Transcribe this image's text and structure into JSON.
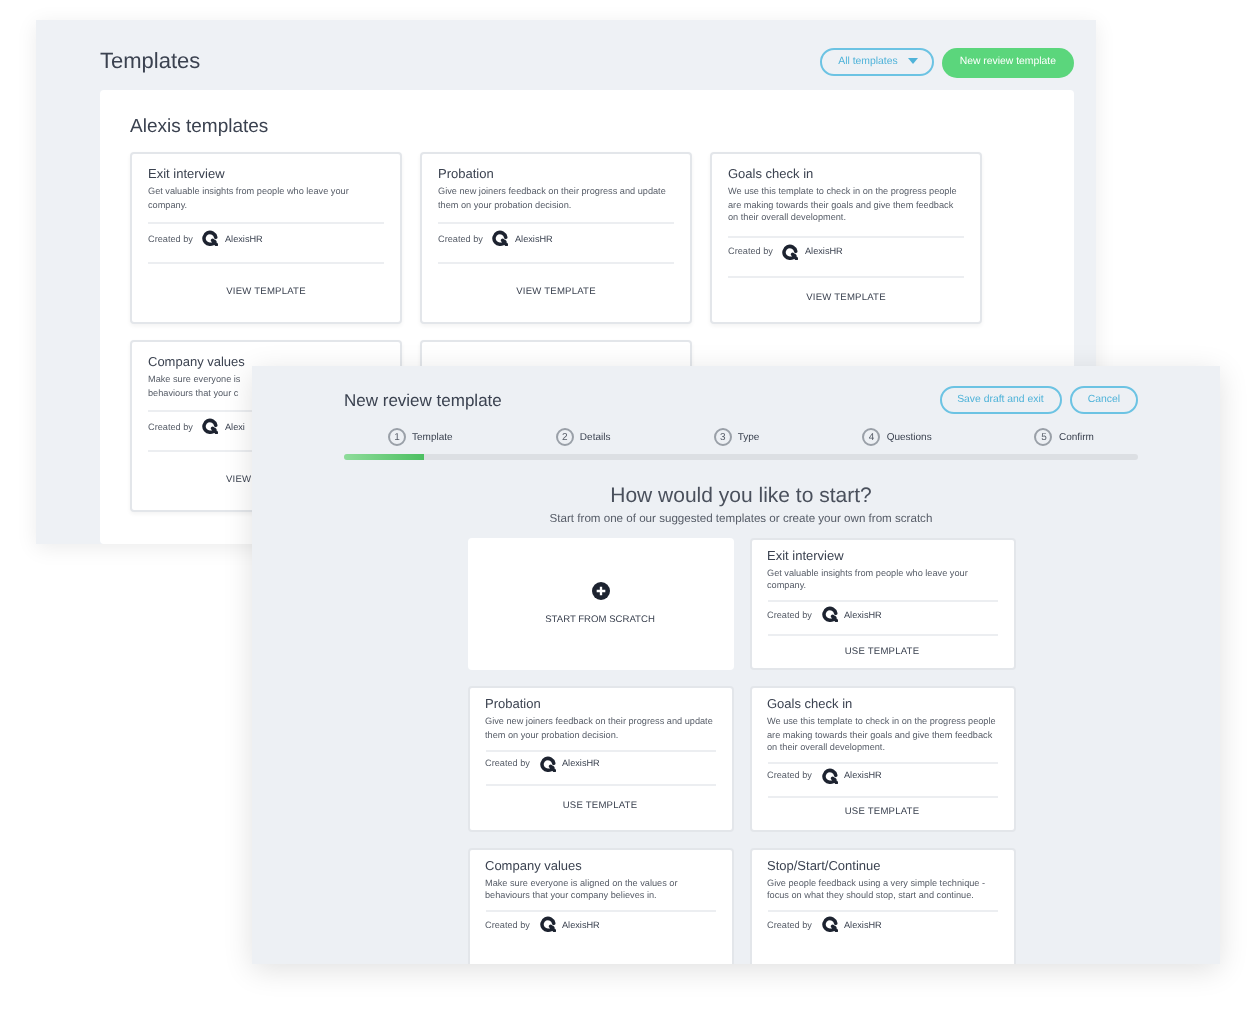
{
  "back_window": {
    "title": "Templates",
    "filter": {
      "label": "All templates"
    },
    "primary_button": "New review template",
    "section_title": "Alexis templates",
    "cards": [
      {
        "kind": "template",
        "title": "Exit interview",
        "description": "Get valuable insights from people who leave your company.",
        "created_by_label": "Created by",
        "creator": "AlexisHR",
        "action": "VIEW TEMPLATE"
      },
      {
        "kind": "template",
        "title": "Probation",
        "description": "Give new joiners feedback on their progress and update them on your probation decision.",
        "created_by_label": "Created by",
        "creator": "AlexisHR",
        "action": "VIEW TEMPLATE"
      },
      {
        "kind": "template",
        "title": "Goals check in",
        "description": "We use this template to check in on the progress people are making towards their goals and give them feedback on their overall development.",
        "created_by_label": "Created by",
        "creator": "AlexisHR",
        "action": "VIEW TEMPLATE"
      },
      {
        "kind": "partial",
        "title": "Company values",
        "description_lines": [
          "Make sure everyone is",
          "behaviours that your c"
        ],
        "created_by_label": "Created by",
        "creator": "Alexi",
        "action": "VIEW"
      },
      {
        "kind": "covered"
      }
    ]
  },
  "front_window": {
    "title": "New review template",
    "buttons": [
      "Save draft and exit",
      "Cancel"
    ],
    "steps": [
      {
        "number": "1",
        "label": "Template"
      },
      {
        "number": "2",
        "label": "Details"
      },
      {
        "number": "3",
        "label": "Type"
      },
      {
        "number": "4",
        "label": "Questions"
      },
      {
        "number": "5",
        "label": "Confirm"
      }
    ],
    "progress": {
      "level": 0.1
    },
    "heading": "How would you like to start?",
    "subheading": "Start from one of our suggested templates or create your own from scratch",
    "options": [
      {
        "kind": "scratch",
        "label": "START FROM SCRATCH"
      },
      {
        "kind": "template",
        "title": "Exit interview",
        "description": "Get valuable insights from people who leave your company.",
        "created_by_label": "Created by",
        "creator": "AlexisHR",
        "action": "USE TEMPLATE"
      },
      {
        "kind": "template",
        "title": "Probation",
        "description": "Give new joiners feedback on their progress and update them on your probation decision.",
        "created_by_label": "Created by",
        "creator": "AlexisHR",
        "action": "USE TEMPLATE"
      },
      {
        "kind": "template",
        "title": "Goals check in",
        "description": "We use this template to check in on the progress people are making towards their goals and give them feedback on their overall development.",
        "created_by_label": "Created by",
        "creator": "AlexisHR",
        "action": "USE TEMPLATE"
      },
      {
        "kind": "template",
        "title": "Company values",
        "description": "Make sure everyone is aligned on the values or behaviours that your company believes in.",
        "created_by_label": "Created by",
        "creator": "AlexisHR"
      },
      {
        "kind": "template",
        "title": "Stop/Start/Continue",
        "description": "Give people feedback using a very simple technique - focus on what they should stop, start and continue.",
        "created_by_label": "Created by",
        "creator": "AlexisHR"
      }
    ]
  }
}
